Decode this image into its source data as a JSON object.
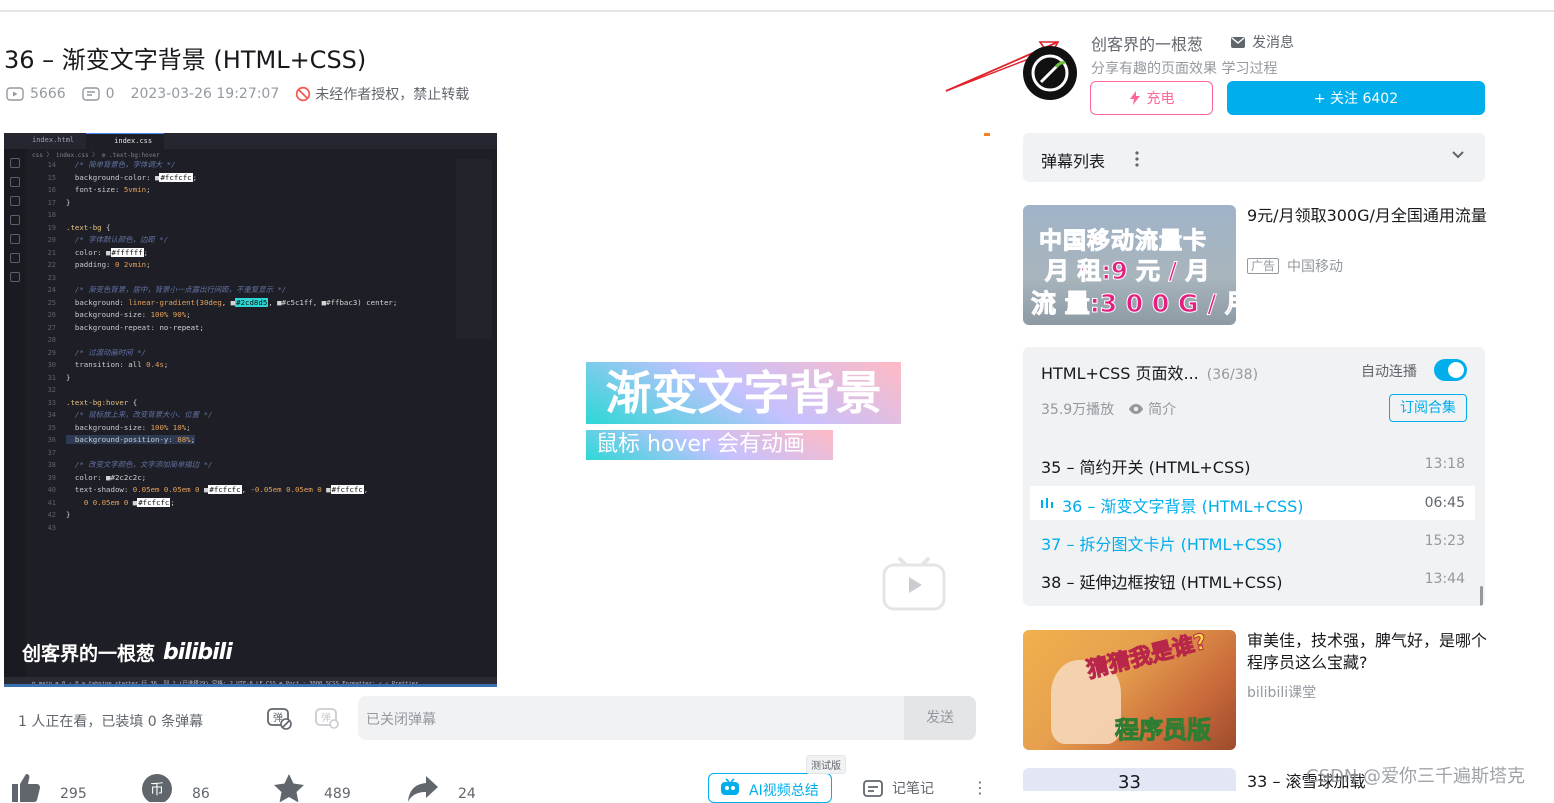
{
  "video": {
    "title": "36 – 渐变文字背景 (HTML+CSS)",
    "views": "5666",
    "danmaku_count": "0",
    "date": "2023-03-26 19:27:07",
    "copyright": "未经作者授权，禁止转载"
  },
  "editor": {
    "tabs": [
      "index.html",
      "index.css"
    ],
    "breadcrumb": "css 〉 index.css 〉 ⚙ .text-bg:hover",
    "line_numbers": "14\n15\n16\n17\n18\n19\n20\n21\n22\n23\n24\n25\n26\n27\n28\n29\n30\n31\n32\n33\n34\n35\n36\n37\n38\n39\n40\n41\n42\n43",
    "status": "ꝑ main   ⊗ 0 ⚠ 0   ⊙ tabnine starter                              行 36, 列 1 (已选择29)   空格: 2   UTF-8   LF   CSS   ⊕ Port : 3000   SCSS Formatter: ✓   ✓ Prettier"
  },
  "watermark": {
    "author": "创客界的一根葱",
    "brand": "bilibili"
  },
  "preview": {
    "title": "渐变文字背景",
    "subtitle": "鼠标 hover 会有动画"
  },
  "danmaku_bar": {
    "watching": "1 人正在看，已装填 0 条弹幕",
    "input_placeholder": "已关闭弹幕",
    "send": "发送"
  },
  "toolbar": {
    "like": "295",
    "coin": "86",
    "fav": "489",
    "share": "24",
    "ai_summary": "AI视频总结",
    "ai_tag": "测试版",
    "notes": "记笔记"
  },
  "author": {
    "name": "创客界的一根葱",
    "message": "发消息",
    "desc": "分享有趣的页面效果 学习过程",
    "charge": "充电",
    "follow": "+ 关注 6402"
  },
  "danmaku_list": {
    "label": "弹幕列表"
  },
  "ad": {
    "line1": "中国移动流量卡",
    "line2": "月 租:9 元 / 月",
    "line3": "流 量:3 0 0 G / 月",
    "title": "9元/月领取300G/月全国通用流量",
    "tag": "广告",
    "sponsor": "中国移动"
  },
  "playlist": {
    "title": "HTML+CSS 页面效...",
    "count": "(36/38)",
    "autoplay": "自动连播",
    "plays": "35.9万播放",
    "intro": "简介",
    "subscribe": "订阅合集",
    "items": [
      {
        "title": "35 – 简约开关 (HTML+CSS)",
        "duration": "13:18"
      },
      {
        "title": "36 – 渐变文字背景 (HTML+CSS)",
        "duration": "06:45"
      },
      {
        "title": "37 – 拆分图文卡片 (HTML+CSS)",
        "duration": "15:23"
      },
      {
        "title": "38 – 延伸边框按钮 (HTML+CSS)",
        "duration": "13:44"
      }
    ]
  },
  "recommend": [
    {
      "title": "审美佳，技术强，脾气好，是哪个程序员这么宝藏?",
      "uploader": "bilibili课堂",
      "thumb_top": "猜猜我是谁?",
      "thumb_bottom": "程序员版"
    },
    {
      "title": "33 – 滚雪球加载",
      "thumb": "33"
    }
  ],
  "csdn_watermark": "CSDN @爱你三千遍斯塔克",
  "colors": {
    "accent": "#00aeec",
    "charge": "#ff6699",
    "gradient": [
      "#2cd8d5",
      "#c5c1ff",
      "#ffbac3"
    ]
  }
}
